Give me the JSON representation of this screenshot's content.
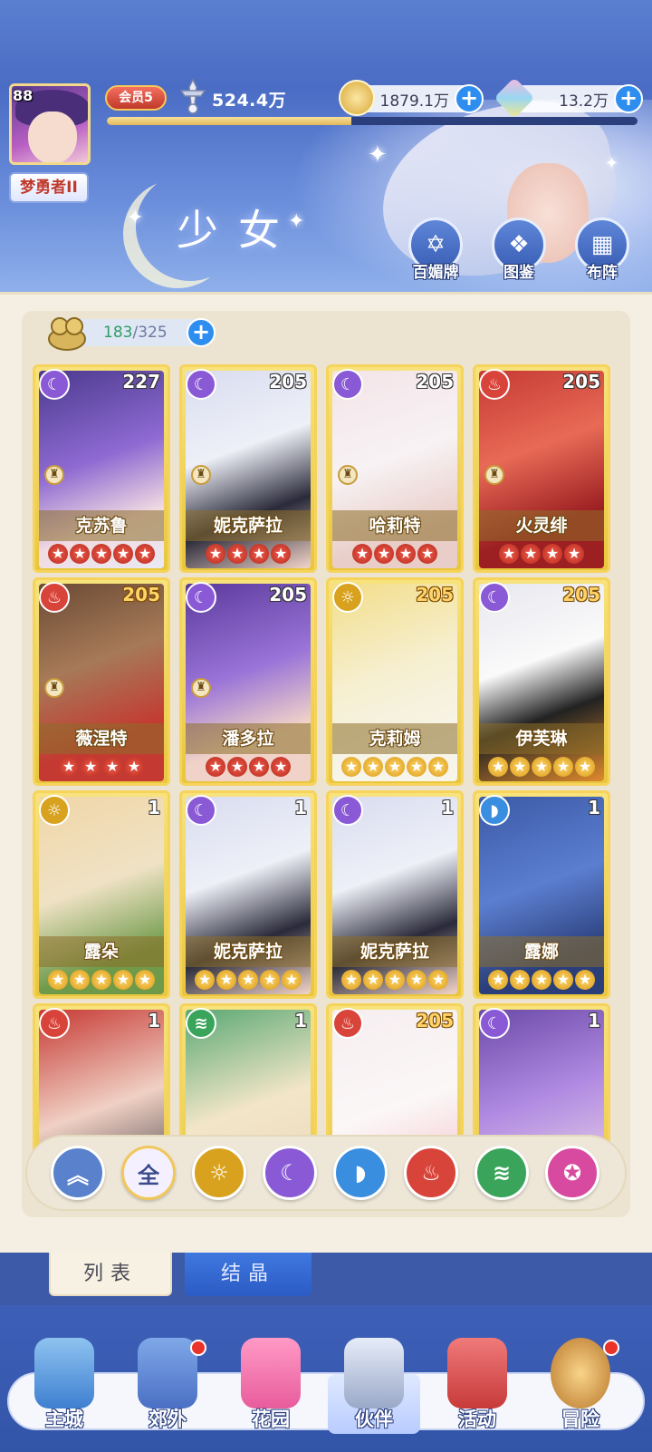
{
  "player": {
    "level": "88",
    "title": "梦勇者II",
    "vip": "会员5",
    "power": "524.4万",
    "exp_fraction": 0.46
  },
  "resources": [
    {
      "name": "gold",
      "value": "1879.1万"
    },
    {
      "name": "diamond",
      "value": "13.2万"
    }
  ],
  "page_title": "少女",
  "header_buttons": [
    {
      "label": "百媚牌",
      "icon": "star-badge-icon"
    },
    {
      "label": "图鉴",
      "icon": "book-icon"
    },
    {
      "label": "布阵",
      "icon": "grid-formation-icon"
    }
  ],
  "inventory": {
    "current": "183",
    "separator": "/",
    "max": "325"
  },
  "element_colors": {
    "moon": "#8a5ad6",
    "fire": "#d9443a",
    "sun": "#d8a21e",
    "water": "#3a8ee0",
    "wind": "#3aa55a",
    "star": "#d84aa0"
  },
  "cards": [
    {
      "name": "克苏鲁",
      "level": "227",
      "element": "moon",
      "stars": 5,
      "star_color": "red",
      "has_chess": true,
      "level_gold": false
    },
    {
      "name": "妮克萨拉",
      "level": "205",
      "element": "moon",
      "stars": 4,
      "star_color": "red",
      "has_chess": true,
      "level_gold": false
    },
    {
      "name": "哈莉特",
      "level": "205",
      "element": "moon",
      "stars": 4,
      "star_color": "red",
      "has_chess": true,
      "level_gold": false
    },
    {
      "name": "火灵绯",
      "level": "205",
      "element": "fire",
      "stars": 4,
      "star_color": "red",
      "has_chess": true,
      "level_gold": false
    },
    {
      "name": "薇涅特",
      "level": "205",
      "element": "fire",
      "stars": 4,
      "star_color": "red",
      "has_chess": true,
      "level_gold": true
    },
    {
      "name": "潘多拉",
      "level": "205",
      "element": "moon",
      "stars": 4,
      "star_color": "red",
      "has_chess": true,
      "level_gold": false
    },
    {
      "name": "克莉姆",
      "level": "205",
      "element": "sun",
      "stars": 5,
      "star_color": "gold",
      "has_chess": false,
      "level_gold": true
    },
    {
      "name": "伊芙琳",
      "level": "205",
      "element": "moon",
      "stars": 5,
      "star_color": "gold",
      "has_chess": false,
      "level_gold": true
    },
    {
      "name": "露朵",
      "level": "1",
      "element": "sun",
      "stars": 5,
      "star_color": "gold",
      "has_chess": false,
      "level_gold": false
    },
    {
      "name": "妮克萨拉",
      "level": "1",
      "element": "moon",
      "stars": 5,
      "star_color": "gold",
      "has_chess": false,
      "level_gold": false
    },
    {
      "name": "妮克萨拉",
      "level": "1",
      "element": "moon",
      "stars": 5,
      "star_color": "gold",
      "has_chess": false,
      "level_gold": false
    },
    {
      "name": "露娜",
      "level": "1",
      "element": "water",
      "stars": 5,
      "star_color": "gold",
      "has_chess": false,
      "level_gold": false
    },
    {
      "name": "",
      "level": "1",
      "element": "fire",
      "stars": 0,
      "star_color": "gold",
      "has_chess": false,
      "level_gold": false
    },
    {
      "name": "",
      "level": "1",
      "element": "wind",
      "stars": 0,
      "star_color": "gold",
      "has_chess": false,
      "level_gold": false
    },
    {
      "name": "",
      "level": "205",
      "element": "fire",
      "stars": 0,
      "star_color": "gold",
      "has_chess": false,
      "level_gold": true
    },
    {
      "name": "",
      "level": "1",
      "element": "moon",
      "stars": 0,
      "star_color": "gold",
      "has_chess": false,
      "level_gold": false
    }
  ],
  "filters": [
    {
      "key": "collapse",
      "label": "",
      "icon": "chevron-up-icon",
      "color": "#5a82cc"
    },
    {
      "key": "all",
      "label": "全",
      "icon": "",
      "color": "#f4f0ff"
    },
    {
      "key": "sun",
      "label": "",
      "icon": "sun-icon",
      "color": "#d8a21e"
    },
    {
      "key": "moon",
      "label": "",
      "icon": "moon-icon",
      "color": "#8a5ad6"
    },
    {
      "key": "water",
      "label": "",
      "icon": "water-drop-icon",
      "color": "#3a8ee0"
    },
    {
      "key": "fire",
      "label": "",
      "icon": "fire-icon",
      "color": "#d9443a"
    },
    {
      "key": "wind",
      "label": "",
      "icon": "wind-icon",
      "color": "#3aa55a"
    },
    {
      "key": "star",
      "label": "",
      "icon": "star-orb-icon",
      "color": "#d84aa0"
    }
  ],
  "tabs": {
    "list": "列表",
    "crystal": "结晶"
  },
  "bottom_nav": [
    {
      "label": "主城",
      "icon": "castle-icon",
      "dot": false
    },
    {
      "label": "郊外",
      "icon": "magic-circle-icon",
      "dot": true
    },
    {
      "label": "花园",
      "icon": "heart-icon",
      "dot": false
    },
    {
      "label": "伙伴",
      "icon": "partner-portrait-icon",
      "dot": false
    },
    {
      "label": "活动",
      "icon": "gift-box-icon",
      "dot": false
    },
    {
      "label": "冒险",
      "icon": "compass-icon",
      "dot": true
    }
  ]
}
